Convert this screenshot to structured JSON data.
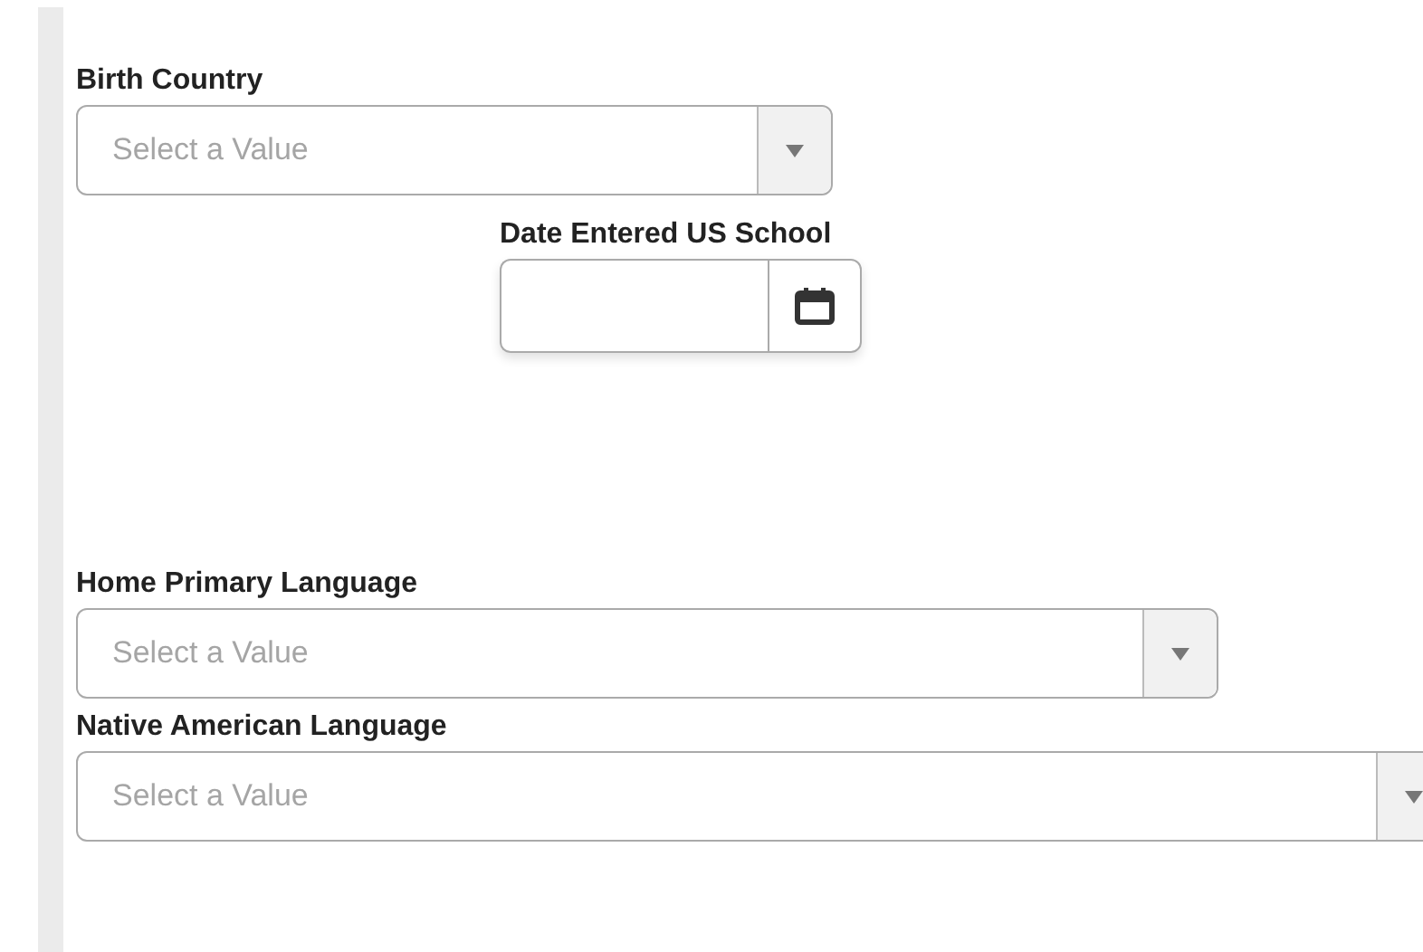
{
  "fields": [
    {
      "kind": "select",
      "label": "Birth Country",
      "placeholder": "Select a Value"
    },
    {
      "kind": "date",
      "label": "Date Entered US School"
    },
    {
      "kind": "select",
      "label": "Home Primary Language",
      "placeholder": "Select a Value"
    },
    {
      "kind": "select",
      "label": "Native American Language",
      "placeholder": "Select a Value"
    }
  ]
}
